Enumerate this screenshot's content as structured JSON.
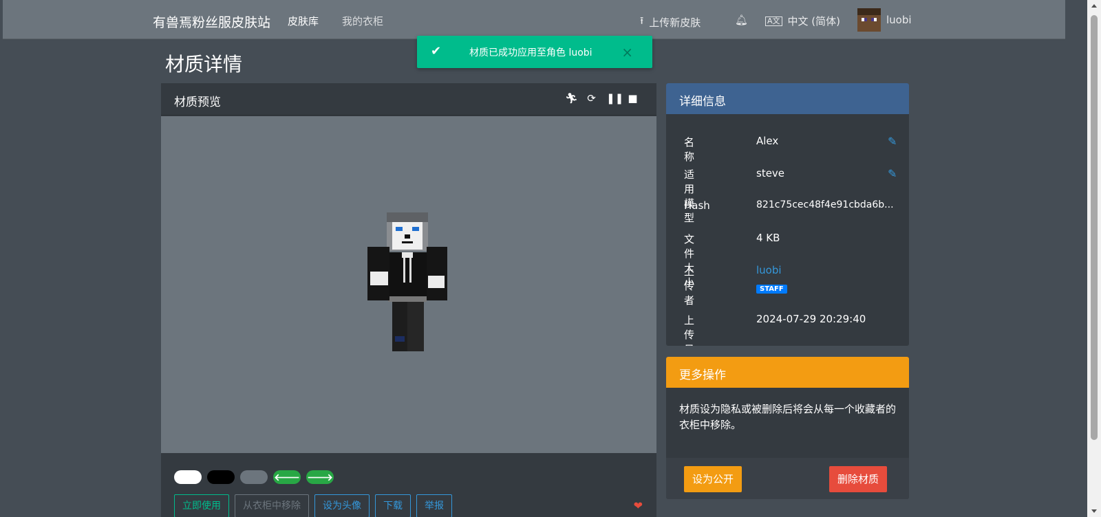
{
  "nav": {
    "brand": "有兽焉粉丝服皮肤站",
    "links": [
      "皮肤库",
      "我的衣柜"
    ],
    "upload": "上传新皮肤",
    "language": "中文 (简体)",
    "username": "luobi"
  },
  "toast": {
    "message": "材质已成功应用至角色 luobi"
  },
  "page": {
    "title": "材质详情"
  },
  "preview": {
    "title": "材质预览",
    "swatch_colors": [
      "#ffffff",
      "#000000",
      "#6c757d",
      "#28a745",
      "#28a745"
    ],
    "buttons": [
      "立即使用",
      "从衣柜中移除",
      "设为头像",
      "下载",
      "举报"
    ]
  },
  "details": {
    "title": "详细信息",
    "rows": [
      {
        "label": "名称",
        "value": "Alex"
      },
      {
        "label": "适用模型",
        "value": "steve"
      },
      {
        "label": "Hash",
        "value": "821c75cec48f4e91cbda6b..."
      },
      {
        "label": "文件大小",
        "value": "4 KB"
      },
      {
        "label": "上传者",
        "value": "luobi",
        "badge": "STAFF"
      },
      {
        "label": "上传日期",
        "value": "2024-07-29 20:29:40"
      }
    ]
  },
  "more": {
    "title": "更多操作",
    "text": "材质设为隐私或被删除后将会从每一个收藏者的衣柜中移除。",
    "make_public": "设为公开",
    "delete": "删除材质"
  },
  "colors": {
    "success": "#00bc8c",
    "info_header": "#3e6391",
    "warning_header": "#f39c12",
    "danger": "#e74c3c",
    "link": "#3498db"
  }
}
